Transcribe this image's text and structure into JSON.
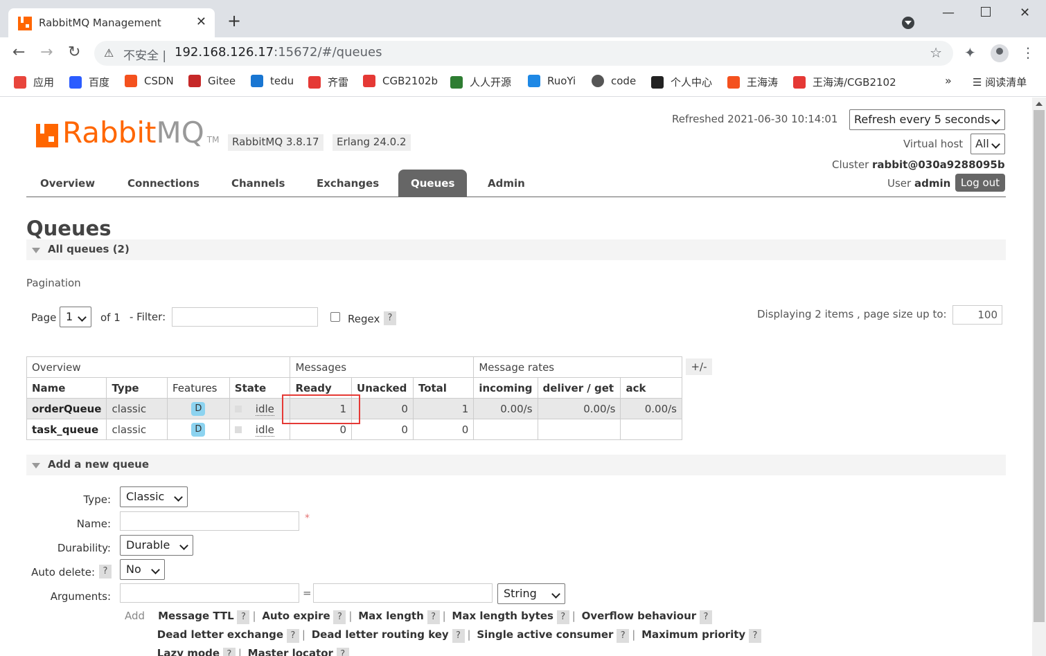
{
  "browser": {
    "tab_title": "RabbitMQ Management",
    "insecure_label": "不安全 |",
    "url_host": "192.168.126.17",
    "url_rest": ":15672/#/queues",
    "bookmarks": [
      "应用",
      "百度",
      "CSDN",
      "Gitee",
      "tedu",
      "齐雷",
      "CGB2102b",
      "人人开源",
      "RuoYi",
      "code",
      "个人中心",
      "王海涛",
      "王海涛/CGB2102"
    ],
    "bookmark_colors": [
      "#e8453c",
      "#2b5cff",
      "#f4511e",
      "#c62828",
      "#1976d2",
      "#e53935",
      "#e53935",
      "#2e7d32",
      "#1e88e5",
      "#555555",
      "#222222",
      "#f4511e",
      "#e53935"
    ],
    "bookmarks_more": "»",
    "reading_list": "阅读清单"
  },
  "header": {
    "logo_rabbit": "Rabbit",
    "logo_mq": "MQ",
    "logo_tm": "TM",
    "version": "RabbitMQ 3.8.17",
    "erlang": "Erlang 24.0.2",
    "refreshed": "Refreshed 2021-06-30 10:14:01",
    "refresh_option": "Refresh every 5 seconds",
    "vhost_label": "Virtual host",
    "vhost_value": "All",
    "cluster_label": "Cluster",
    "cluster_value": "rabbit@030a9288095b",
    "user_label": "User",
    "user_value": "admin",
    "logout": "Log out"
  },
  "nav": {
    "tabs": [
      "Overview",
      "Connections",
      "Channels",
      "Exchanges",
      "Queues",
      "Admin"
    ],
    "active": "Queues"
  },
  "page": {
    "title": "Queues",
    "all_queues": "All queues (2)",
    "pagination": "Pagination",
    "page_label": "Page",
    "page_value": "1",
    "of_label": "of 1",
    "filter_label": "- Filter:",
    "regex_label": "Regex",
    "help": "?",
    "displaying": "Displaying 2 items , page size up to:",
    "page_size": "100",
    "plusminus": "+/-"
  },
  "table": {
    "groups": [
      "Overview",
      "Messages",
      "Message rates"
    ],
    "columns": [
      "Name",
      "Type",
      "Features",
      "State",
      "Ready",
      "Unacked",
      "Total",
      "incoming",
      "deliver / get",
      "ack"
    ],
    "rows": [
      {
        "name": "orderQueue",
        "type": "classic",
        "feature": "D",
        "state": "idle",
        "ready": "1",
        "unacked": "0",
        "total": "1",
        "incoming": "0.00/s",
        "deliver": "0.00/s",
        "ack": "0.00/s"
      },
      {
        "name": "task_queue",
        "type": "classic",
        "feature": "D",
        "state": "idle",
        "ready": "0",
        "unacked": "0",
        "total": "0",
        "incoming": "",
        "deliver": "",
        "ack": ""
      }
    ]
  },
  "add_queue": {
    "section": "Add a new queue",
    "type_label": "Type:",
    "type_value": "Classic",
    "name_label": "Name:",
    "required_mark": "*",
    "durability_label": "Durability:",
    "durability_value": "Durable",
    "auto_delete_label": "Auto delete:",
    "auto_delete_value": "No",
    "arguments_label": "Arguments:",
    "equals": "=",
    "arg_type": "String",
    "add": "Add",
    "arg_links": [
      "Message TTL",
      "Auto expire",
      "Max length",
      "Max length bytes",
      "Overflow behaviour",
      "Dead letter exchange",
      "Dead letter routing key",
      "Single active consumer",
      "Maximum priority",
      "Lazy mode",
      "Master locator"
    ]
  }
}
